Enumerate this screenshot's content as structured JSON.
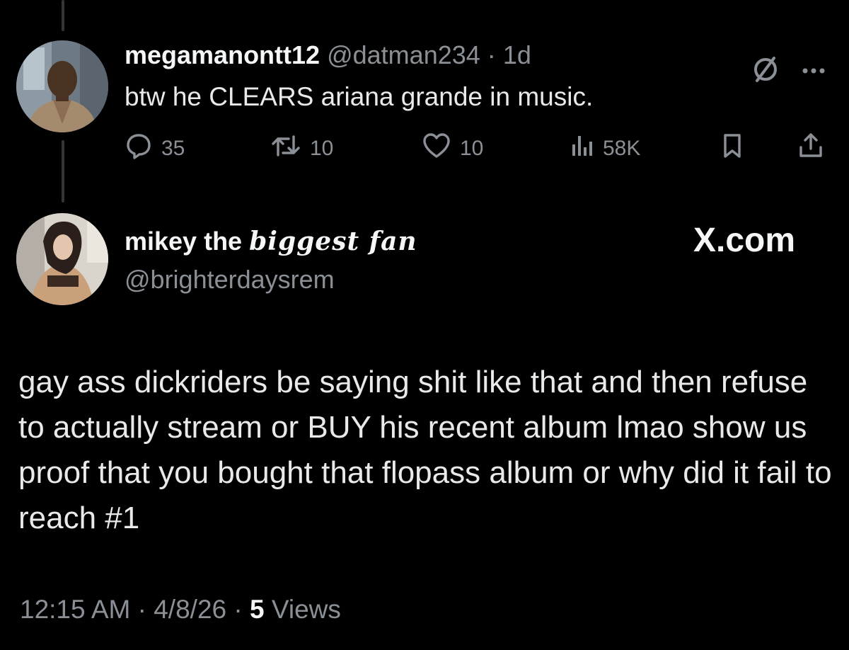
{
  "parent_tweet": {
    "display_name": "megamanontt12",
    "handle": "@datman234",
    "separator": "·",
    "time": "1d",
    "text": "btw he CLEARS ariana grande in music.",
    "reply_count": "35",
    "repost_count": "10",
    "like_count": "10",
    "view_count": "58K",
    "icons": [
      "grok-icon",
      "more-icon",
      "reply-icon",
      "repost-icon",
      "like-icon",
      "views-icon",
      "bookmark-icon",
      "share-icon"
    ]
  },
  "main_tweet": {
    "display_name": "mikey the",
    "display_name_fancy": "biggest fan",
    "handle": "@brighterdaysrem",
    "text": "gay ass dickriders be saying shit like that and then refuse to actually stream or BUY his recent album lmao show us proof that you bought that flopass album or why did it fail to reach #1",
    "time": "12:15 AM",
    "sep": "·",
    "date": "4/8/26",
    "views_count": "5",
    "views_label": "Views"
  },
  "brand": "X.com",
  "colors": {
    "background": "#000000",
    "text": "#e7e9ea",
    "muted": "#8b9096",
    "thread_line": "#333639"
  }
}
